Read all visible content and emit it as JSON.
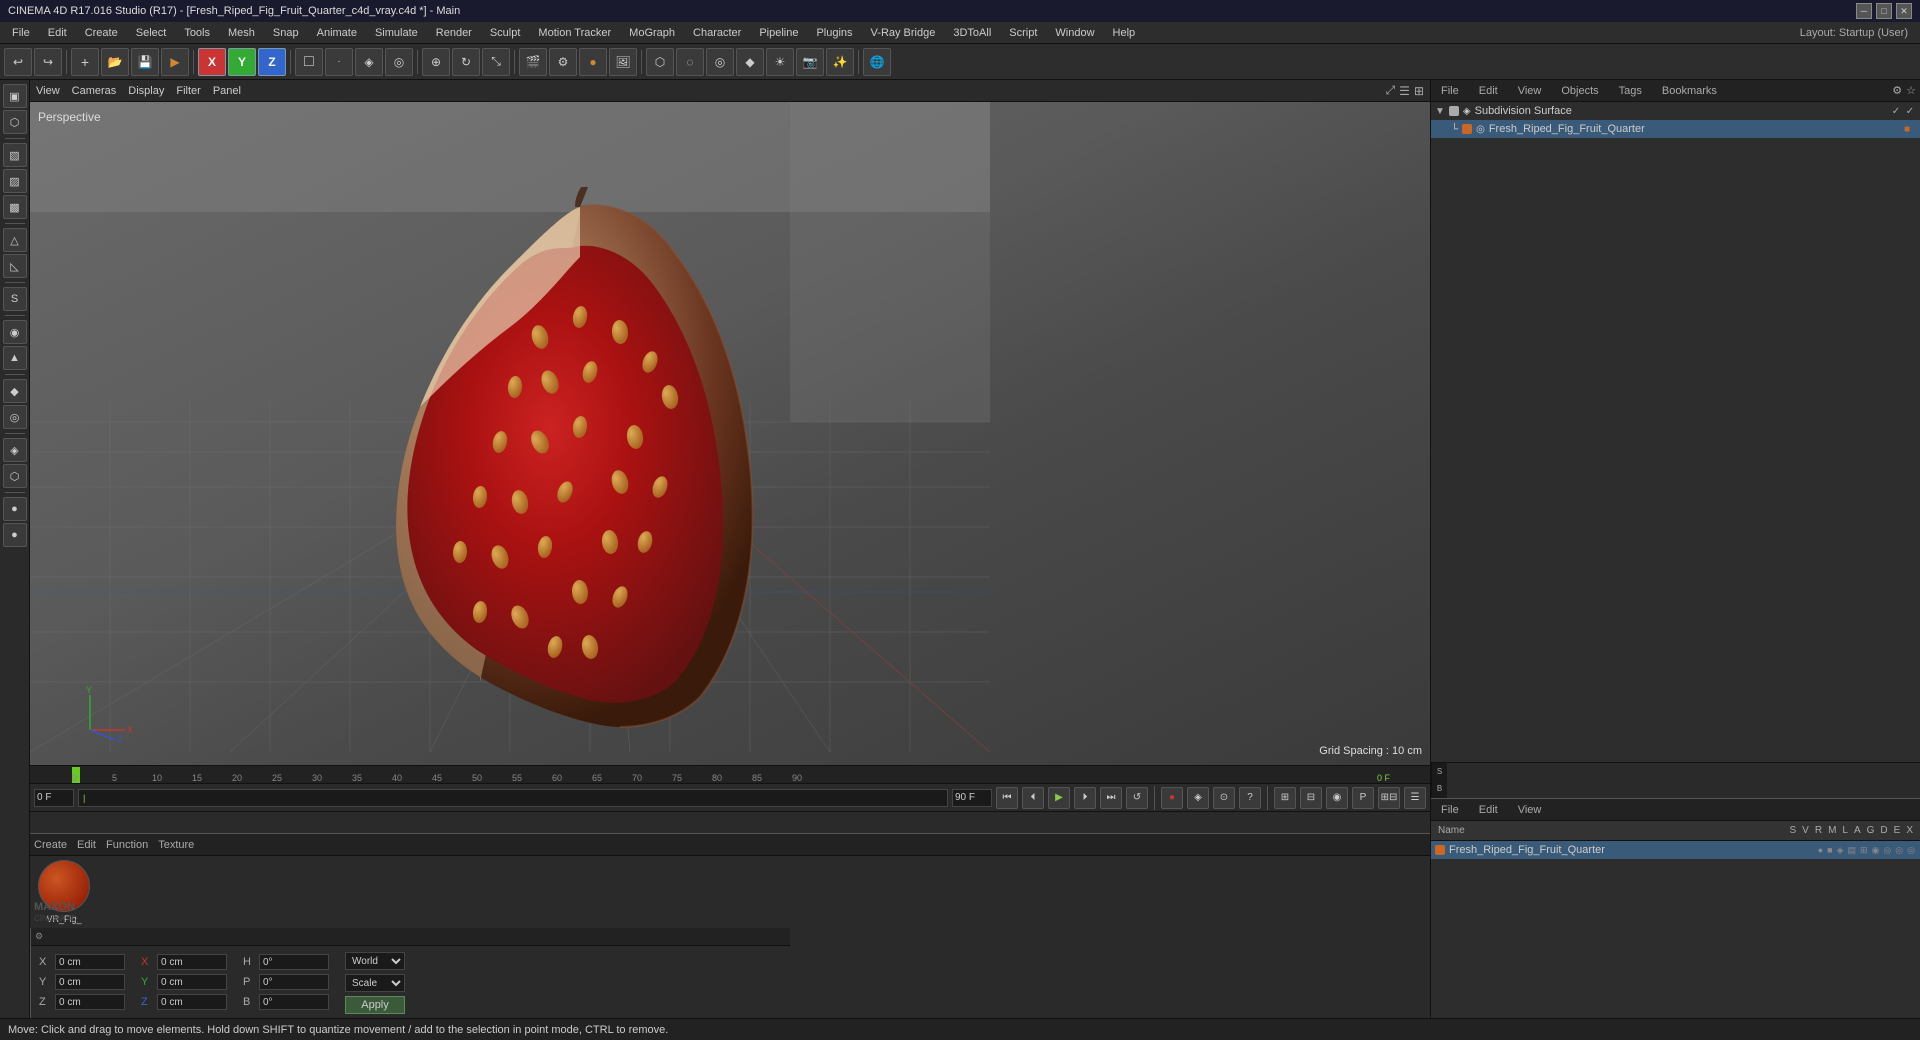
{
  "titlebar": {
    "title": "CINEMA 4D R17.016 Studio (R17) - [Fresh_Riped_Fig_Fruit_Quarter_c4d_vray.c4d *] - Main",
    "minimize": "─",
    "maximize": "□",
    "close": "✕"
  },
  "layout_label": "Layout: Startup (User)",
  "menu": {
    "items": [
      "File",
      "Edit",
      "Create",
      "Select",
      "Tools",
      "Mesh",
      "Snap",
      "Animate",
      "Simulate",
      "Render",
      "Sculpt",
      "Motion Tracker",
      "MoGraph",
      "Character",
      "Pipeline",
      "Plugins",
      "V-Ray Bridge",
      "3DToAll",
      "Script",
      "Window",
      "Help"
    ]
  },
  "toolbar": {
    "tools": [
      "↩",
      "↪",
      "⊕",
      "⊕",
      "⊕",
      "⊕",
      "X",
      "Y",
      "Z",
      "■",
      "▣",
      "◈",
      "◉",
      "◎",
      "⬡",
      "◌",
      "◎",
      "◆",
      "◇",
      "●",
      "⬢",
      "⬡",
      "▤"
    ]
  },
  "viewport": {
    "perspective_label": "Perspective",
    "grid_spacing": "Grid Spacing : 10 cm",
    "header_items": [
      "View",
      "Cameras",
      "Display",
      "Filter",
      "Panel"
    ]
  },
  "right_panel": {
    "object_manager_top": {
      "tabs": [
        "File",
        "Edit",
        "View",
        "Objects",
        "Tags",
        "Bookmarks"
      ],
      "items": [
        {
          "name": "Subdivision Surface",
          "color": "#aaaaaa",
          "indent": 0,
          "icons": [
            "✓",
            "✓"
          ]
        },
        {
          "name": "Fresh_Riped_Fig_Fruit_Quarter",
          "color": "#cc6622",
          "indent": 1,
          "icons": []
        }
      ]
    },
    "object_manager_bottom": {
      "tabs": [
        "File",
        "Edit",
        "View"
      ],
      "columns": [
        "Name",
        "S",
        "V",
        "R",
        "M",
        "L",
        "A",
        "G",
        "D",
        "E",
        "X"
      ],
      "items": [
        {
          "name": "Fresh_Riped_Fig_Fruit_Quarter",
          "color": "#cc6622",
          "icons": [
            "●",
            "■",
            "▣",
            "▤",
            "⊞",
            "⊟",
            "◎",
            "◎",
            "◎"
          ]
        }
      ]
    }
  },
  "timeline": {
    "frame_start": "0 F",
    "frame_current": "0 F",
    "frame_end": "90 F",
    "ticks": [
      "0",
      "5",
      "10",
      "15",
      "20",
      "25",
      "30",
      "35",
      "40",
      "45",
      "50",
      "55",
      "60",
      "65",
      "70",
      "75",
      "80",
      "85",
      "90"
    ],
    "current_frame_display": "0 F"
  },
  "playback": {
    "buttons": [
      "⏮",
      "⏪",
      "⏴",
      "▶",
      "⏵",
      "⏩",
      "⏭",
      "↺"
    ]
  },
  "material_editor": {
    "tabs": [
      "Create",
      "Edit",
      "Function",
      "Texture"
    ],
    "material_name": "VR_Fig_"
  },
  "coordinates": {
    "x_pos": "0 cm",
    "y_pos": "0 cm",
    "z_pos": "0 cm",
    "x_rot": "0°",
    "y_rot": "0°",
    "z_rot": "0°",
    "x_scale": "0 cm",
    "y_scale": "0 cm",
    "z_scale": "0 cm",
    "h_val": "0°",
    "p_val": "0°",
    "b_val": "0°",
    "coord_system": "World",
    "mode": "Scale",
    "apply_label": "Apply"
  },
  "status_bar": {
    "message": "Move: Click and drag to move elements. Hold down SHIFT to quantize movement / add to the selection in point mode, CTRL to remove."
  },
  "left_toolbar": {
    "tools": [
      "■",
      "▦",
      "▧",
      "▨",
      "△",
      "╱",
      "S",
      "◉",
      "▲",
      "◆",
      "◎",
      "◈",
      "⬡",
      "●"
    ]
  }
}
